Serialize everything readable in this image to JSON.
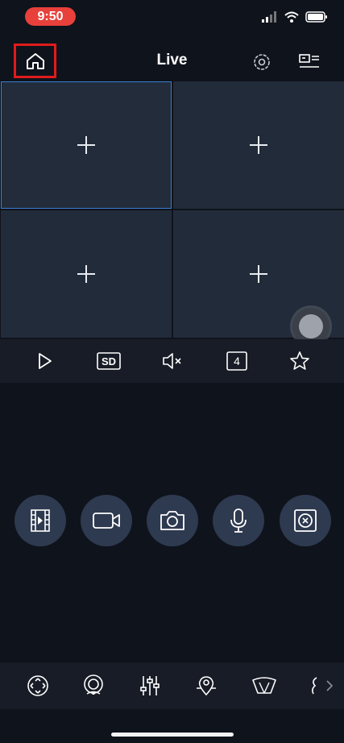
{
  "status": {
    "time": "9:50"
  },
  "nav": {
    "title": "Live"
  },
  "grid": {
    "cells": [
      "+",
      "+",
      "+",
      "+"
    ]
  },
  "control_bar": {
    "quality_label": "SD",
    "layout_count": "4"
  },
  "icons": {
    "home": "home-icon",
    "settings": "settings-icon",
    "layout": "device-list-icon",
    "play": "play-icon",
    "mute": "mute-icon",
    "favorite": "star-icon",
    "record": "video-record-icon",
    "camera": "video-camera-icon",
    "snapshot": "snapshot-icon",
    "talk": "microphone-icon",
    "fisheye": "fisheye-icon",
    "ptz": "ptz-control-icon",
    "eye": "eye-icon",
    "adjust": "adjust-sliders-icon",
    "location": "location-icon",
    "wiper": "wiper-icon"
  },
  "colors": {
    "background": "#0f131c",
    "cell": "#222b39",
    "selected_border": "#3a7fd6",
    "action_button": "#2e3a4f",
    "highlight": "#e01b1b"
  }
}
